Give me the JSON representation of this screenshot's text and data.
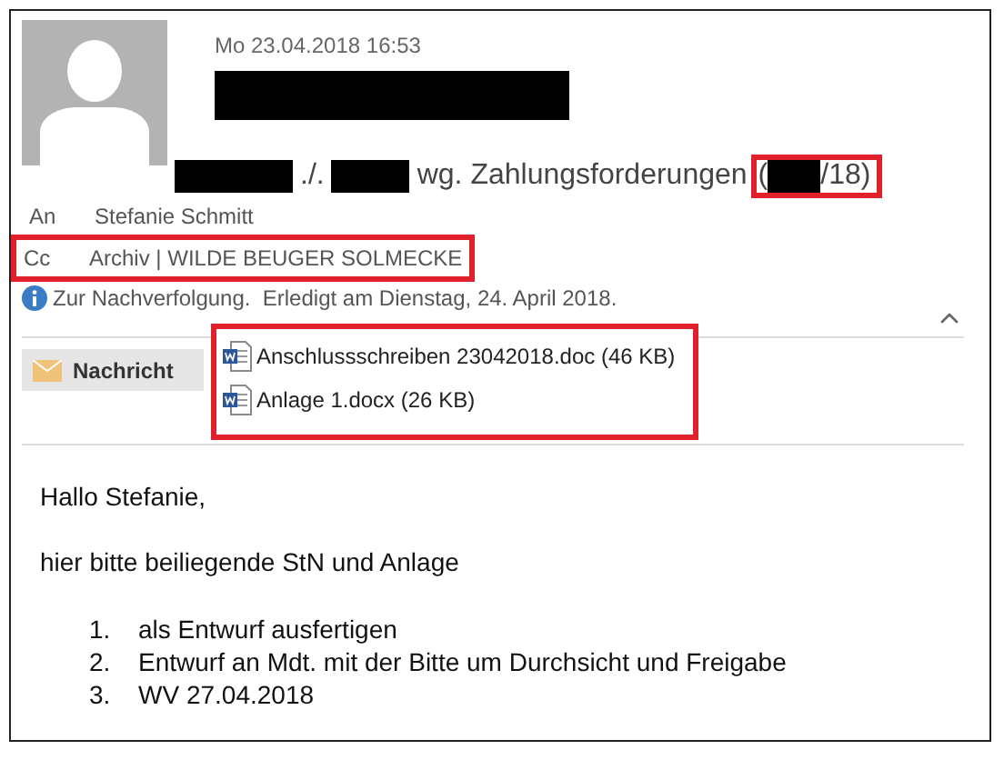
{
  "header": {
    "date": "Mo 23.04.2018 16:53",
    "title_redacted": true,
    "subject": [
      {
        "kind": "redacted"
      },
      {
        "kind": "text",
        "text": "./."
      },
      {
        "kind": "redacted"
      },
      {
        "kind": "text",
        "text": "wg. Zahlungsforderungen"
      }
    ],
    "subject_highlighted": [
      {
        "kind": "text",
        "text": "("
      },
      {
        "kind": "redacted"
      },
      {
        "kind": "text",
        "text": "/18)"
      }
    ]
  },
  "recipients": [
    {
      "label": "An",
      "value": "Stefanie Schmitt",
      "highlighted": false
    },
    {
      "label": "Cc",
      "value": "Archiv | WILDE BEUGER SOLMECKE",
      "highlighted": true
    }
  ],
  "info": "Zur Nachverfolgung.  Erledigt am Dienstag, 24. April 2018.",
  "collapse": {
    "expanded": true
  },
  "message_button": "Nachricht",
  "attachments_highlighted": true,
  "attachments": [
    {
      "name": "Anschlussschreiben 23042018.doc (46 KB)"
    },
    {
      "name": "Anlage 1.docx (26 KB)"
    }
  ],
  "body": {
    "greeting": "Hallo Stefanie,",
    "text": "hier bitte beiliegende StN und Anlage",
    "items": [
      {
        "number": "1.",
        "text": "als Entwurf ausfertigen"
      },
      {
        "number": "2.",
        "text": "Entwurf an Mdt. mit der Bitte um Durchsicht und Freigabe"
      },
      {
        "number": "3.",
        "text": "WV 27.04.2018"
      }
    ]
  }
}
